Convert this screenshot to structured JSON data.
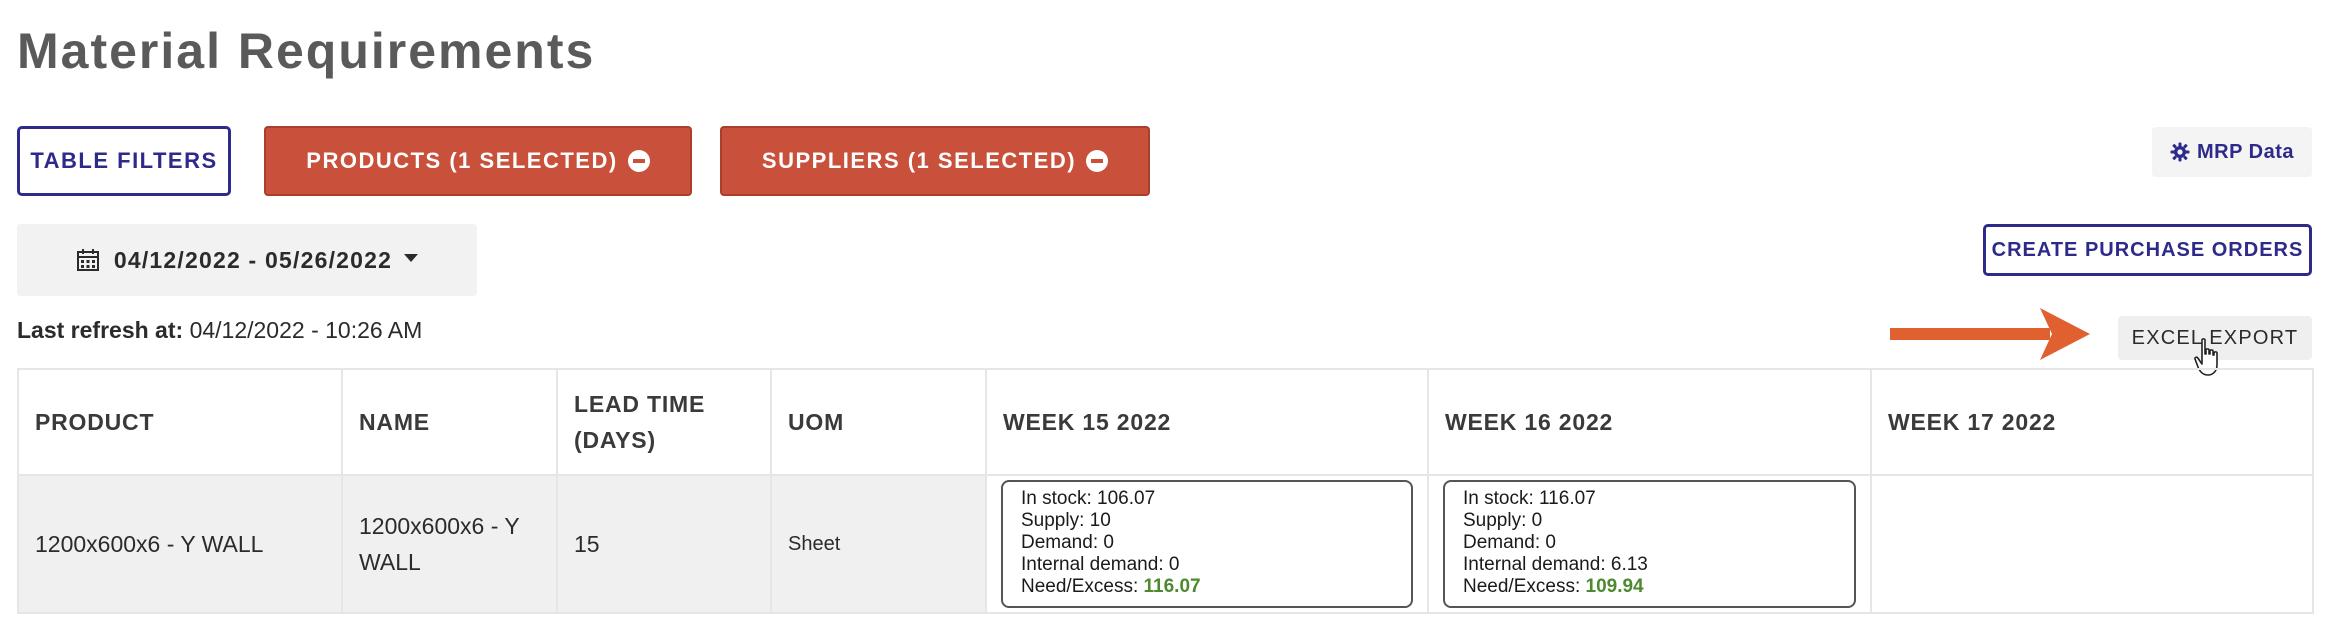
{
  "page": {
    "title": "Material Requirements"
  },
  "toolbar": {
    "table_filters": "TABLE FILTERS",
    "products": "PRODUCTS (1 SELECTED)",
    "suppliers": "SUPPLIERS (1 SELECTED)",
    "mrp_data": "MRP Data",
    "create_po": "CREATE PURCHASE ORDERS",
    "excel_export": "EXCEL EXPORT"
  },
  "date_range": {
    "value": "04/12/2022 - 05/26/2022"
  },
  "refresh": {
    "label": "Last refresh at:",
    "value": "04/12/2022 - 10:26 AM"
  },
  "table": {
    "headers": {
      "product": "PRODUCT",
      "name": "NAME",
      "lead_time": "LEAD TIME (DAYS)",
      "uom": "UOM",
      "week15": "WEEK 15 2022",
      "week16": "WEEK 16 2022",
      "week17": "WEEK 17 2022"
    },
    "rows": [
      {
        "product": "1200x600x6 - Y WALL",
        "name": "1200x600x6 - Y WALL",
        "lead_time": "15",
        "uom": "Sheet",
        "week15": {
          "in_stock": "In stock: 106.07",
          "supply": "Supply: 10",
          "demand": "Demand: 0",
          "internal_demand": "Internal demand: 0",
          "need_label": "Need/Excess:",
          "need_value": "116.07"
        },
        "week16": {
          "in_stock": "In stock: 116.07",
          "supply": "Supply: 0",
          "demand": "Demand: 0",
          "internal_demand": "Internal demand: 6.13",
          "need_label": "Need/Excess:",
          "need_value": "109.94"
        }
      }
    ]
  },
  "icons": {
    "minus": "minus-circle-icon",
    "gear": "gear-icon",
    "calendar": "calendar-icon",
    "arrow": "arrow-right-icon",
    "cursor": "hand-pointer-icon"
  },
  "colors": {
    "primary": "#2e2a8a",
    "danger": "#c9503a",
    "arrow": "#e0602f",
    "positive": "#4c8a2d"
  }
}
